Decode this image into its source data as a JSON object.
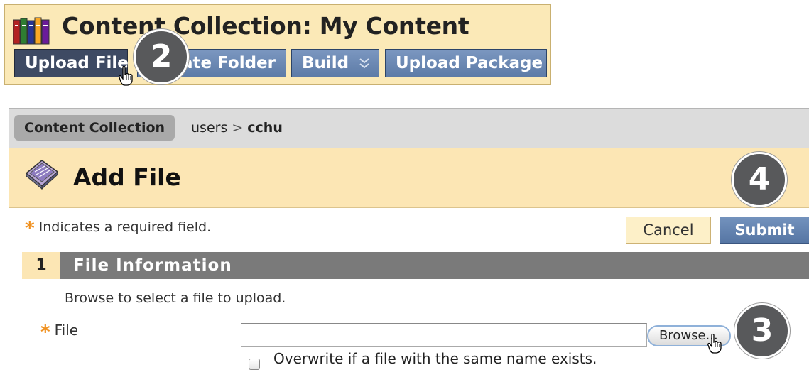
{
  "top": {
    "title": "Content Collection: My Content",
    "buttons": [
      {
        "label": "Upload File"
      },
      {
        "label": "Create Folder"
      },
      {
        "label": "Build »"
      },
      {
        "label": "Upload Package"
      }
    ],
    "build_label": "Build",
    "create_folder_visible": "ate Folder"
  },
  "steps": {
    "two": "2",
    "three": "3",
    "four": "4"
  },
  "breadcrumb": {
    "root": "Content Collection",
    "path": [
      "users",
      "cchu"
    ]
  },
  "page": {
    "title": "Add File",
    "required_note": "Indicates a required field.",
    "cancel_label": "Cancel",
    "submit_label": "Submit"
  },
  "section": {
    "number": "1",
    "title": "File Information",
    "instructions": "Browse to select a file to upload.",
    "file_label": "File",
    "file_value": "",
    "browse_label": "Browse...",
    "overwrite_label": "Overwrite if a file with the same name exists."
  },
  "colors": {
    "panel_bg": "#fbe9b7",
    "button_blue": "#5d7ba7",
    "button_dark": "#3e4a63",
    "required_star": "#f0901e",
    "step_bubble": "#58595b"
  },
  "icons": [
    "books-icon",
    "hand-cursor-icon",
    "add-file-icon",
    "chevron-down-icon",
    "required-star-icon"
  ]
}
